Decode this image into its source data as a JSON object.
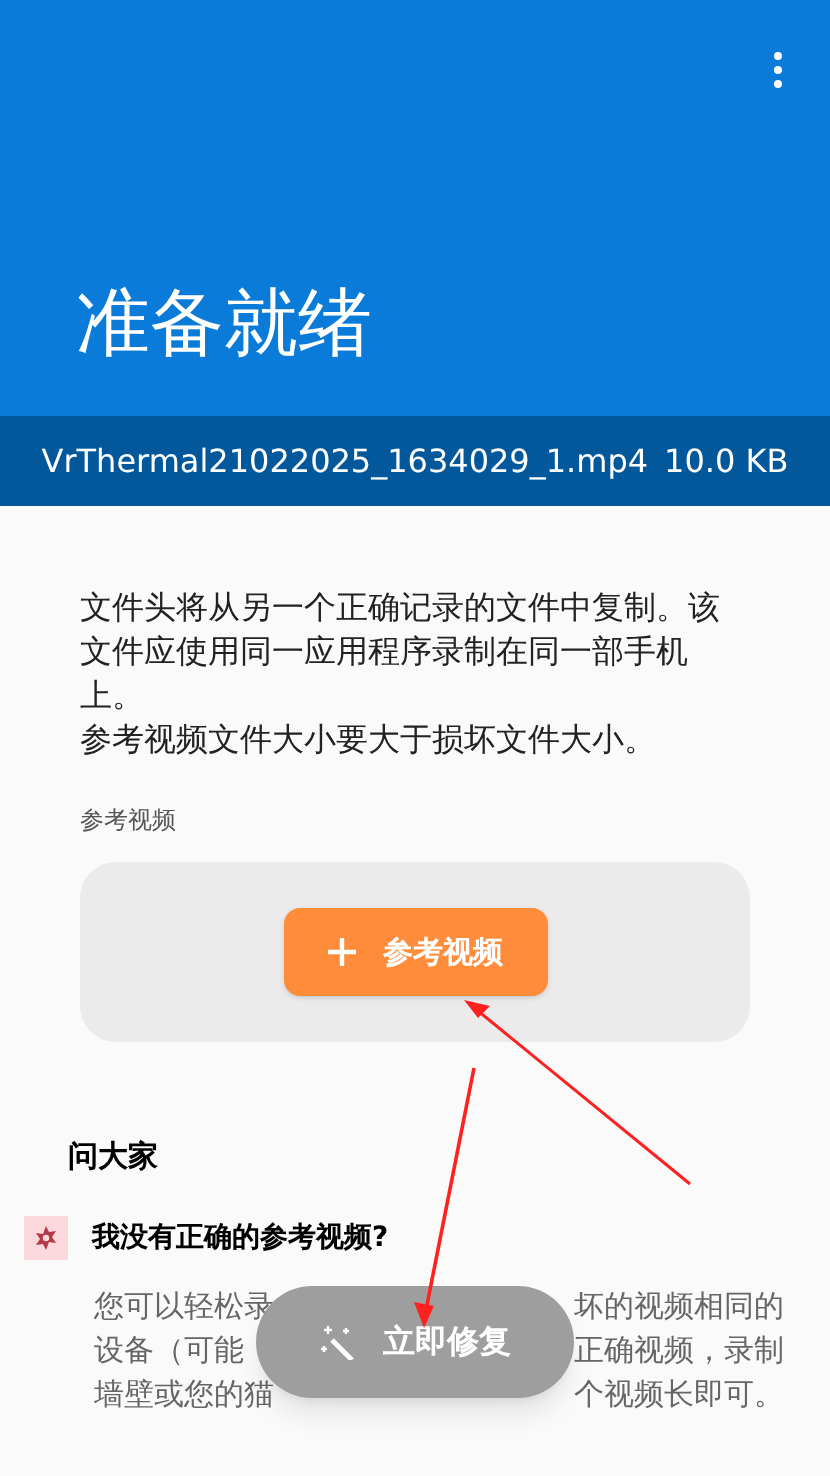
{
  "header": {
    "title": "准备就绪"
  },
  "file_bar": {
    "file_name": "VrThermal21022025_1634029_1.mp4",
    "size": "10.0 KB"
  },
  "description": [
    "文件头将从另一个正确记录的文件中复制。该文件应使用同一应用程序录制在同一部手机上。",
    "参考视频文件大小要大于损坏文件大小。"
  ],
  "reference": {
    "label": "参考视频",
    "button": "参考视频"
  },
  "faq": {
    "title": "问大家",
    "question": "我没有正确的参考视频?",
    "answer_lines": [
      {
        "left": "您可以轻松录",
        "right": "坏的视频相同的"
      },
      {
        "left": "设备（可能",
        "right": "正确视频，录制"
      },
      {
        "left": "墙壁或您的猫",
        "right": "个视频长即可。"
      }
    ]
  },
  "fix_button": {
    "label": "立即修复"
  }
}
